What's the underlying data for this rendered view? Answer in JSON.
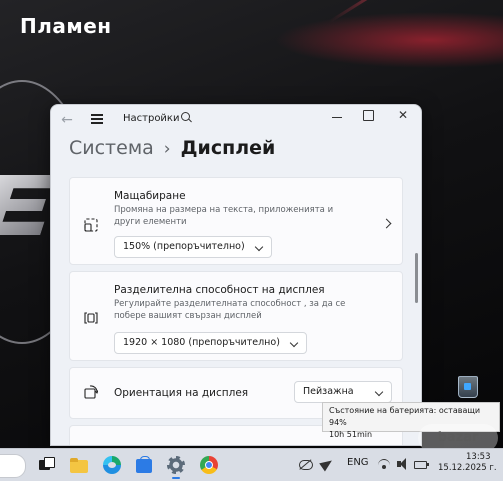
{
  "desktop": {
    "user_name": "Пламен"
  },
  "window": {
    "title": "Настройки",
    "breadcrumb": {
      "parent": "Система",
      "separator": "›",
      "current": "Дисплей"
    },
    "cards": [
      {
        "icon": "scale-icon",
        "title": "Мащабиране",
        "description": "Промяна на размера на текста, приложенията и други елементи",
        "dropdown_value": "150% (препоръчително)",
        "has_arrow": true
      },
      {
        "icon": "resolution-icon",
        "title": "Разделителна способност на дисплея",
        "description": "Регулирайте разделителната способност , за да се поберe вашият свързан дисплей",
        "dropdown_value": "1920 × 1080 (препоръчително)"
      },
      {
        "icon": "orientation-icon",
        "title": "Ориентация на дисплея",
        "dropdown_value": "Пейзажна"
      }
    ]
  },
  "tooltip": {
    "line1": "Състояние на батерията: оставащи 94%",
    "line2": "10h 51min"
  },
  "taskbar": {
    "language": "ENG",
    "time": "13:53",
    "date": "15.12.2025 г."
  },
  "colors": {
    "accent": "#2c7be5",
    "window_bg": "#eef1f6",
    "taskbar_bg": "#d9dde5"
  }
}
